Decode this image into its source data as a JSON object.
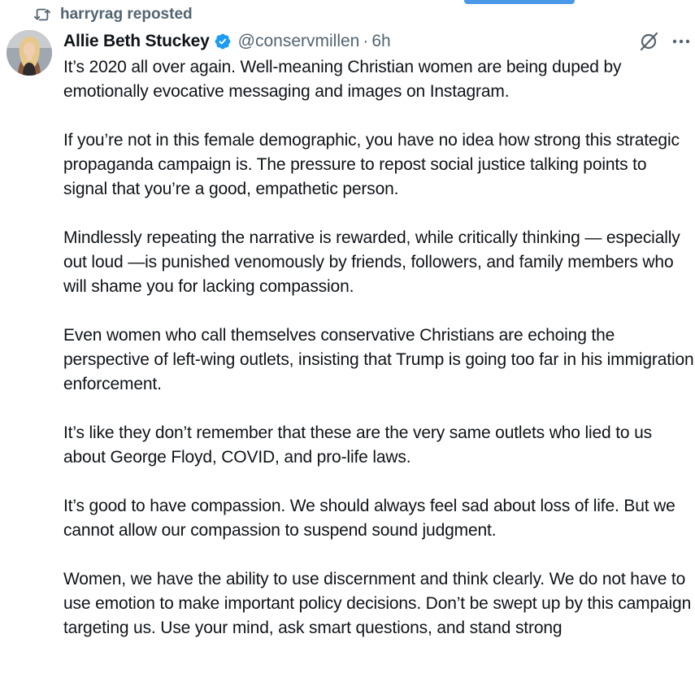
{
  "repost": {
    "icon": "repost-icon",
    "text": "harryrag reposted"
  },
  "tweet": {
    "avatar_icon": "avatar",
    "display_name": "Allie Beth Stuckey",
    "verified_icon": "verified-badge-icon",
    "handle": "@conservmillen",
    "separator": "·",
    "time": "6h",
    "grok_icon": "grok-icon",
    "more_icon": "more-options-icon",
    "paragraphs": [
      "It’s 2020 all over again. Well-meaning Christian women are being duped by emotionally evocative messaging and images on Instagram.",
      "If you’re not in this female demographic, you have no idea how strong this strategic propaganda campaign is. The pressure to repost social justice talking points to signal that you’re a good, empathetic person.",
      "Mindlessly repeating the narrative is rewarded, while critically thinking — especially out loud —is punished venomously by friends, followers, and family members who will shame you for lacking compassion.",
      "Even women who call themselves conservative Christians are echoing the perspective of left-wing outlets, insisting that Trump is going too far in his immigration enforcement.",
      "It’s like they don’t remember that these are the very same outlets who lied to us about George Floyd, COVID, and pro-life laws.",
      "It’s good to have compassion. We should always feel sad about loss of life. But we cannot allow our compassion to suspend sound judgment.",
      "Women, we have the ability to use discernment and think clearly. We do not have to use emotion to make important policy decisions. Don’t be swept up by this campaign targeting us. Use your mind, ask smart questions, and stand strong"
    ]
  },
  "colors": {
    "text_primary": "#0f1419",
    "text_secondary": "#536471",
    "verified_blue": "#1d9bf0",
    "accent_indicator": "#4a99e9"
  }
}
